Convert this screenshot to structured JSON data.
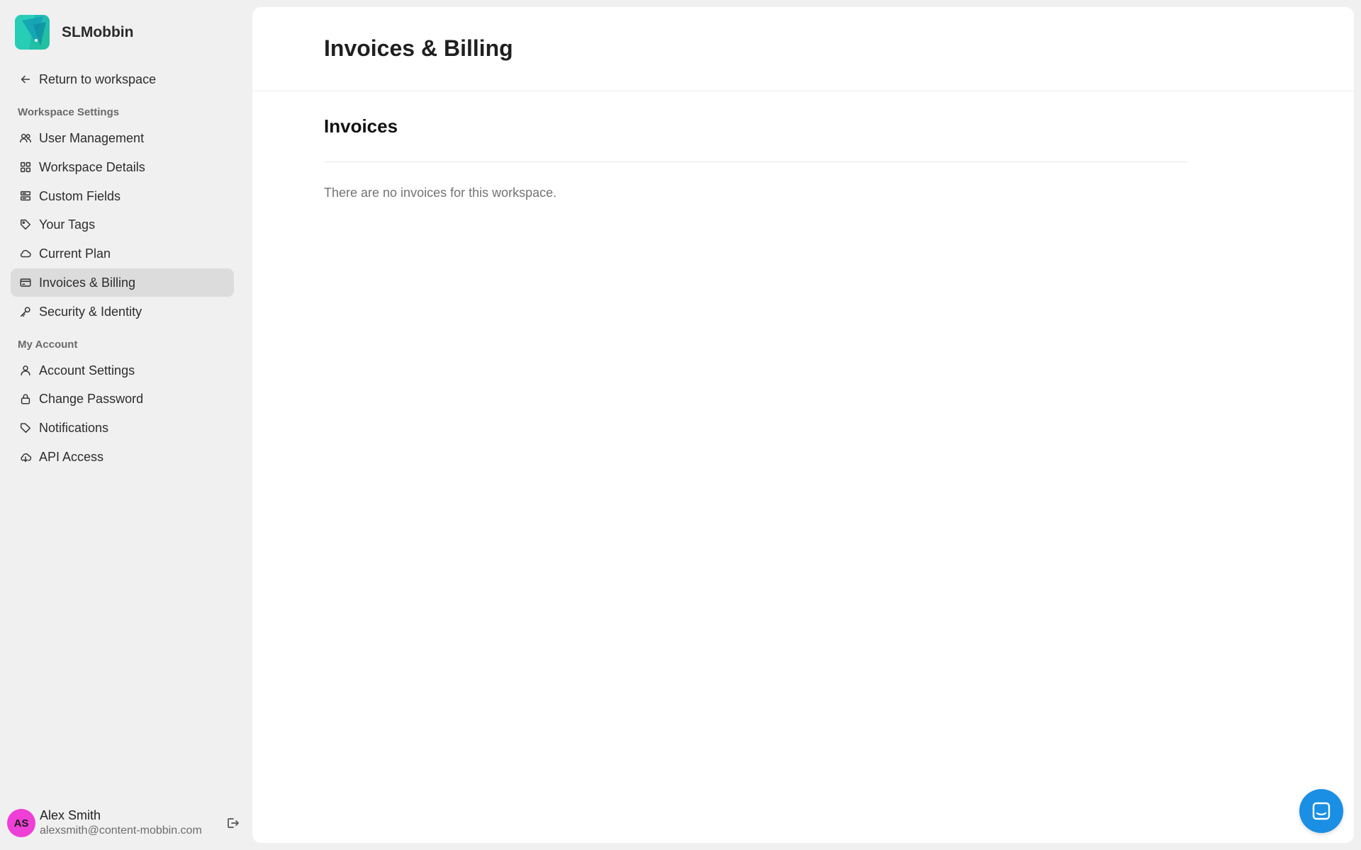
{
  "brand": {
    "name": "SLMobbin"
  },
  "sidebar": {
    "return_label": "Return to workspace",
    "workspace_section_label": "Workspace Settings",
    "workspace_items": [
      {
        "label": "User Management",
        "icon": "users-icon"
      },
      {
        "label": "Workspace Details",
        "icon": "grid-icon"
      },
      {
        "label": "Custom Fields",
        "icon": "fields-icon"
      },
      {
        "label": "Your Tags",
        "icon": "tag-icon"
      },
      {
        "label": "Current Plan",
        "icon": "cloud-icon"
      },
      {
        "label": "Invoices & Billing",
        "icon": "credit-card-icon",
        "active": true
      },
      {
        "label": "Security & Identity",
        "icon": "key-icon"
      }
    ],
    "account_section_label": "My Account",
    "account_items": [
      {
        "label": "Account Settings",
        "icon": "user-icon"
      },
      {
        "label": "Change Password",
        "icon": "lock-icon"
      },
      {
        "label": "Notifications",
        "icon": "notification-tag-icon"
      },
      {
        "label": "API Access",
        "icon": "cloud-download-icon"
      }
    ]
  },
  "user": {
    "initials": "AS",
    "name": "Alex Smith",
    "email": "alexsmith@content-mobbin.com",
    "avatar_color": "#ee3fd6"
  },
  "main": {
    "page_title": "Invoices & Billing",
    "section_title": "Invoices",
    "empty_message": "There are no invoices for this workspace."
  },
  "colors": {
    "sidebar_bg": "#f0f0f0",
    "active_item_bg": "#dcdcdc",
    "chat_button": "#1a8fe3"
  }
}
